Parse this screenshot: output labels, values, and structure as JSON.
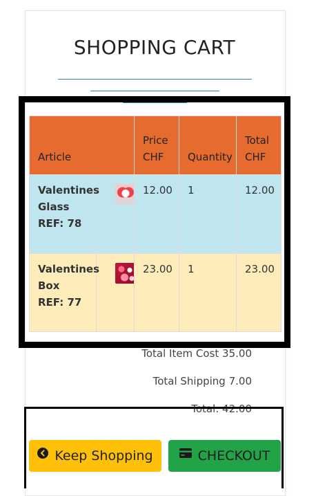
{
  "page": {
    "title": "SHOPPING CART"
  },
  "cart": {
    "headers": {
      "article": "Article",
      "price_line1": "Price",
      "price_line2": "CHF",
      "quantity": "Quantity",
      "total_line1": "Total",
      "total_line2": "CHF"
    },
    "items": [
      {
        "name_line1": "Valentines",
        "name_line2": "Glass",
        "ref": "REF: 78",
        "price": "12.00",
        "quantity": "1",
        "total": "12.00",
        "thumb_icon": "valentines-glass-thumbnail"
      },
      {
        "name_line1": "Valentines",
        "name_line2": "Box",
        "ref": "REF: 77",
        "price": "23.00",
        "quantity": "1",
        "total": "23.00",
        "thumb_icon": "valentines-box-thumbnail"
      }
    ]
  },
  "summary": {
    "item_cost": "Total Item Cost 35.00",
    "shipping": "Total Shipping 7.00",
    "total": "Total: 42.00"
  },
  "buttons": {
    "keep_shopping": "Keep Shopping",
    "keep_shopping_icon": "chevron-left-circle-icon",
    "checkout": "CHECKOUT",
    "checkout_icon": "credit-card-icon"
  },
  "colors": {
    "header_orange": "#e56b2f",
    "row_blue": "#bfe5ee",
    "row_yellow": "#feedbb",
    "keep_shopping_yellow": "#fec107",
    "checkout_green": "#22a348",
    "title_rule": "#2a86a8"
  }
}
